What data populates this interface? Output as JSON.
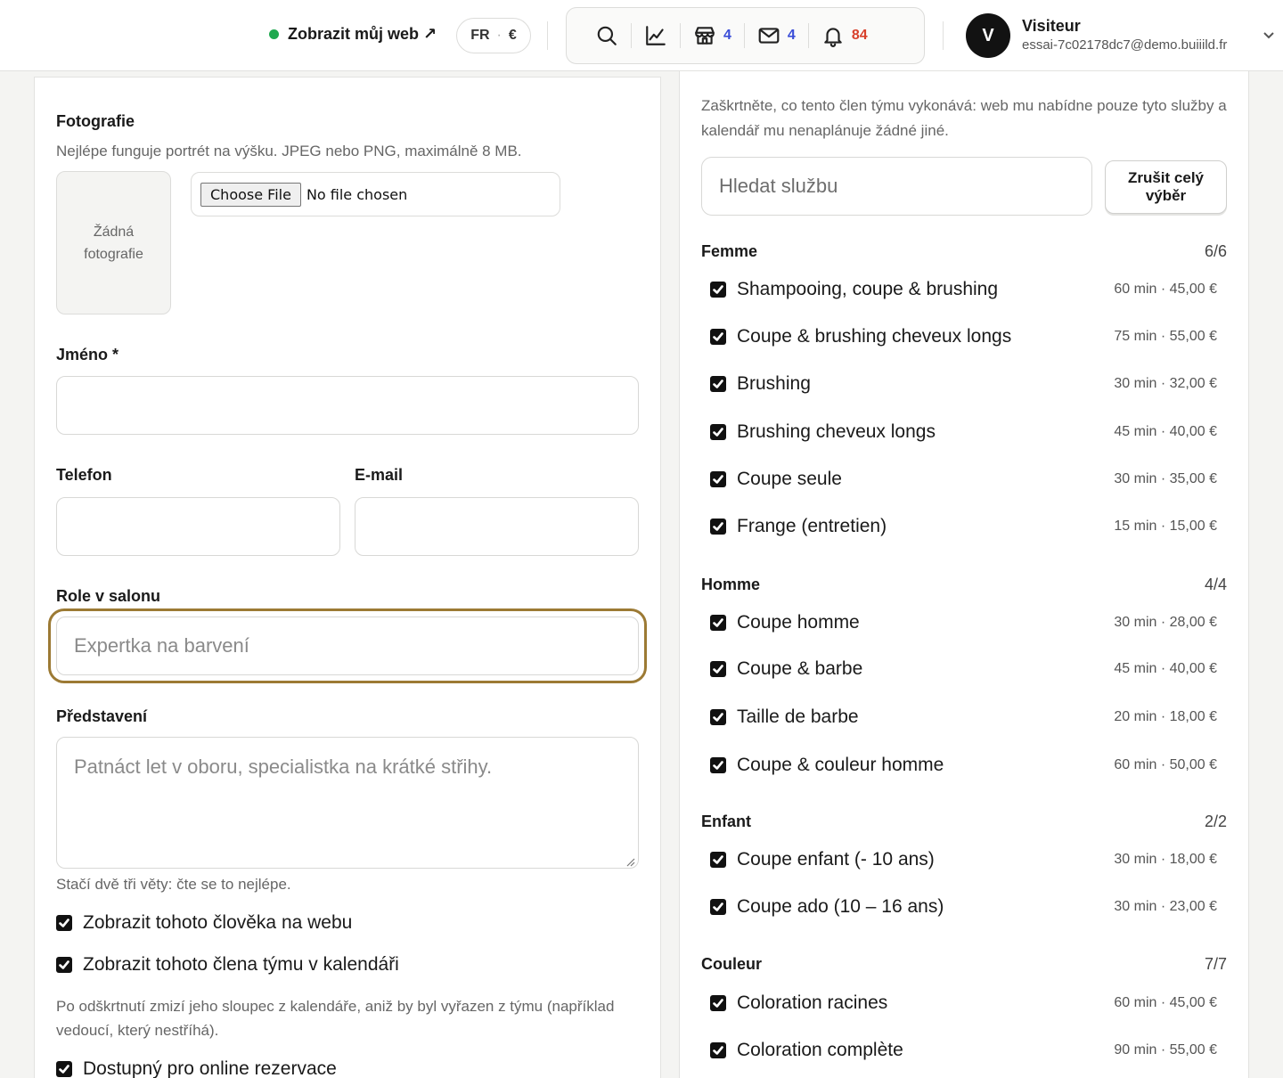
{
  "topbar": {
    "view_site_label": "Zobrazit můj web ↗",
    "lang": "FR",
    "currency": "€",
    "shop_count": "4",
    "mail_count": "4",
    "notif_count": "84",
    "avatar_letter": "V",
    "user_name": "Visiteur",
    "user_email": "essai-7c02178dc7@demo.buiiild.fr",
    "colors": {
      "status_green": "#1fa84f",
      "count_blue": "#3b4ed8",
      "count_red": "#d8402b",
      "focus_ring": "#9c7a34"
    }
  },
  "form": {
    "photo_label": "Fotografie",
    "photo_help": "Nejlépe funguje portrét na výšku. JPEG nebo PNG, maximálně 8 MB.",
    "photo_placeholder": "Žádná fotografie",
    "file_button": "Choose File",
    "file_status": "No file chosen",
    "name_label": "Jméno *",
    "name_value": "",
    "phone_label": "Telefon",
    "phone_value": "",
    "email_label": "E-mail",
    "email_value": "",
    "role_label": "Role v salonu",
    "role_placeholder": "Expertka na barvení",
    "intro_label": "Představení",
    "intro_placeholder": "Patnáct let v oboru, specialistka na krátké střihy.",
    "intro_help": "Stačí dvě tři věty: čte se to nejlépe.",
    "show_on_web_label": "Zobrazit tohoto člověka na webu",
    "show_on_web_checked": true,
    "show_in_calendar_label": "Zobrazit tohoto člena týmu v kalendáři",
    "show_in_calendar_checked": true,
    "calendar_help": "Po odškrtnutí zmizí jeho sloupec z kalendáře, aniž by byl vyřazen z týmu (například vedoucí, který nestříhá).",
    "online_booking_label": "Dostupný pro online rezervace",
    "online_booking_checked": true
  },
  "services": {
    "intro": "Zaškrtněte, co tento člen týmu vykonává: web mu nabídne pouze tyto služby a kalendář mu nenaplánuje žádné jiné.",
    "search_placeholder": "Hledat službu",
    "clear_button": "Zrušit celý výběr",
    "categories": [
      {
        "name": "Femme",
        "count": "6/6",
        "items": [
          {
            "name": "Shampooing, coupe & brushing",
            "meta": "60 min · 45,00 €",
            "checked": true
          },
          {
            "name": "Coupe & brushing cheveux longs",
            "meta": "75 min · 55,00 €",
            "checked": true
          },
          {
            "name": "Brushing",
            "meta": "30 min · 32,00 €",
            "checked": true
          },
          {
            "name": "Brushing cheveux longs",
            "meta": "45 min · 40,00 €",
            "checked": true
          },
          {
            "name": "Coupe seule",
            "meta": "30 min · 35,00 €",
            "checked": true
          },
          {
            "name": "Frange (entretien)",
            "meta": "15 min · 15,00 €",
            "checked": true
          }
        ]
      },
      {
        "name": "Homme",
        "count": "4/4",
        "items": [
          {
            "name": "Coupe homme",
            "meta": "30 min · 28,00 €",
            "checked": true
          },
          {
            "name": "Coupe & barbe",
            "meta": "45 min · 40,00 €",
            "checked": true
          },
          {
            "name": "Taille de barbe",
            "meta": "20 min · 18,00 €",
            "checked": true
          },
          {
            "name": "Coupe & couleur homme",
            "meta": "60 min · 50,00 €",
            "checked": true
          }
        ]
      },
      {
        "name": "Enfant",
        "count": "2/2",
        "items": [
          {
            "name": "Coupe enfant (- 10 ans)",
            "meta": "30 min · 18,00 €",
            "checked": true
          },
          {
            "name": "Coupe ado (10 – 16 ans)",
            "meta": "30 min · 23,00 €",
            "checked": true
          }
        ]
      },
      {
        "name": "Couleur",
        "count": "7/7",
        "items": [
          {
            "name": "Coloration racines",
            "meta": "60 min · 45,00 €",
            "checked": true
          },
          {
            "name": "Coloration complète",
            "meta": "90 min · 55,00 €",
            "checked": true
          }
        ]
      }
    ]
  }
}
